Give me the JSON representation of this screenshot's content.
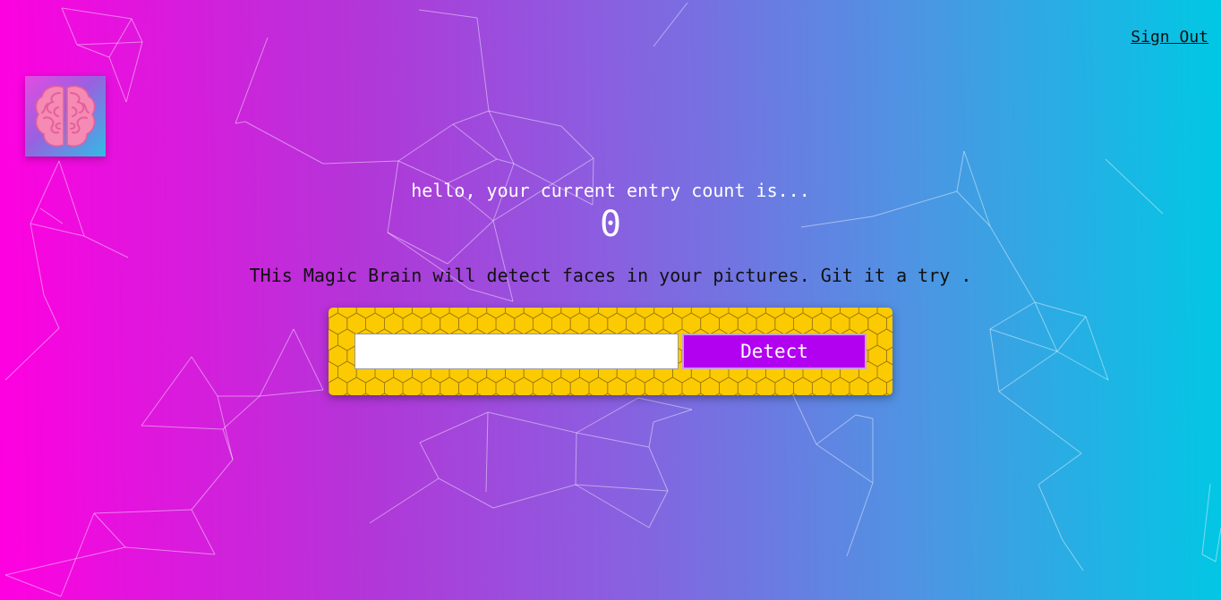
{
  "nav": {
    "sign_out_label": "Sign Out"
  },
  "logo": {
    "icon": "brain-icon"
  },
  "rank": {
    "message": "hello, your current entry count is...",
    "count": "0"
  },
  "intro": {
    "text": "THis Magic Brain will detect faces in your pictures. Git it a try ."
  },
  "form": {
    "input_value": "",
    "input_placeholder": "",
    "detect_label": "Detect"
  },
  "colors": {
    "gradient_left": "#ff00e0",
    "gradient_right": "#00c8e4",
    "panel_yellow": "#fcca00",
    "button_purple": "#b200f0"
  }
}
